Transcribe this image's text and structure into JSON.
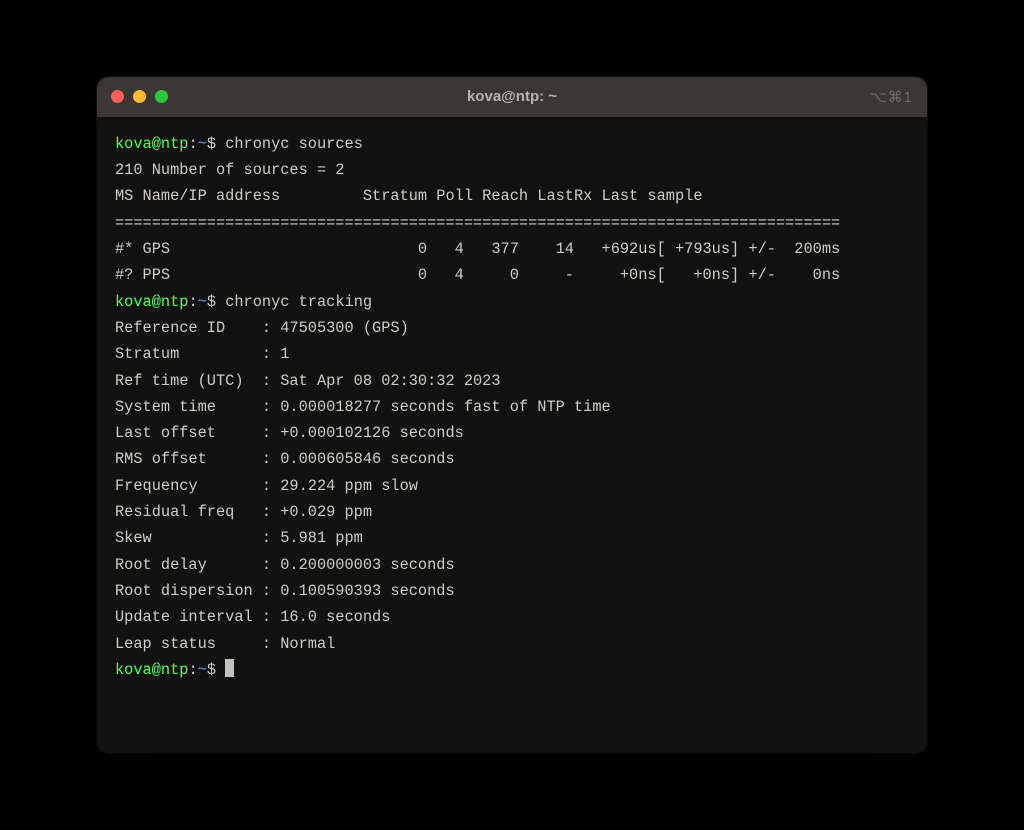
{
  "window": {
    "title": "kova@ntp: ~",
    "shortcut": "⌥⌘1"
  },
  "prompt": {
    "user": "kova@ntp",
    "sep": ":",
    "path": "~",
    "symbol": "$"
  },
  "commands": {
    "c1": "chronyc sources",
    "c2": "chronyc tracking"
  },
  "sources": {
    "count_line": "210 Number of sources = 2",
    "header": "MS Name/IP address         Stratum Poll Reach LastRx Last sample",
    "divider": "===============================================================================",
    "rows": {
      "r1": "#* GPS                           0   4   377    14   +692us[ +793us] +/-  200ms",
      "r2": "#? PPS                           0   4     0     -     +0ns[   +0ns] +/-    0ns"
    }
  },
  "tracking": {
    "l01": "Reference ID    : 47505300 (GPS)",
    "l02": "Stratum         : 1",
    "l03": "Ref time (UTC)  : Sat Apr 08 02:30:32 2023",
    "l04": "System time     : 0.000018277 seconds fast of NTP time",
    "l05": "Last offset     : +0.000102126 seconds",
    "l06": "RMS offset      : 0.000605846 seconds",
    "l07": "Frequency       : 29.224 ppm slow",
    "l08": "Residual freq   : +0.029 ppm",
    "l09": "Skew            : 5.981 ppm",
    "l10": "Root delay      : 0.200000003 seconds",
    "l11": "Root dispersion : 0.100590393 seconds",
    "l12": "Update interval : 16.0 seconds",
    "l13": "Leap status     : Normal"
  }
}
